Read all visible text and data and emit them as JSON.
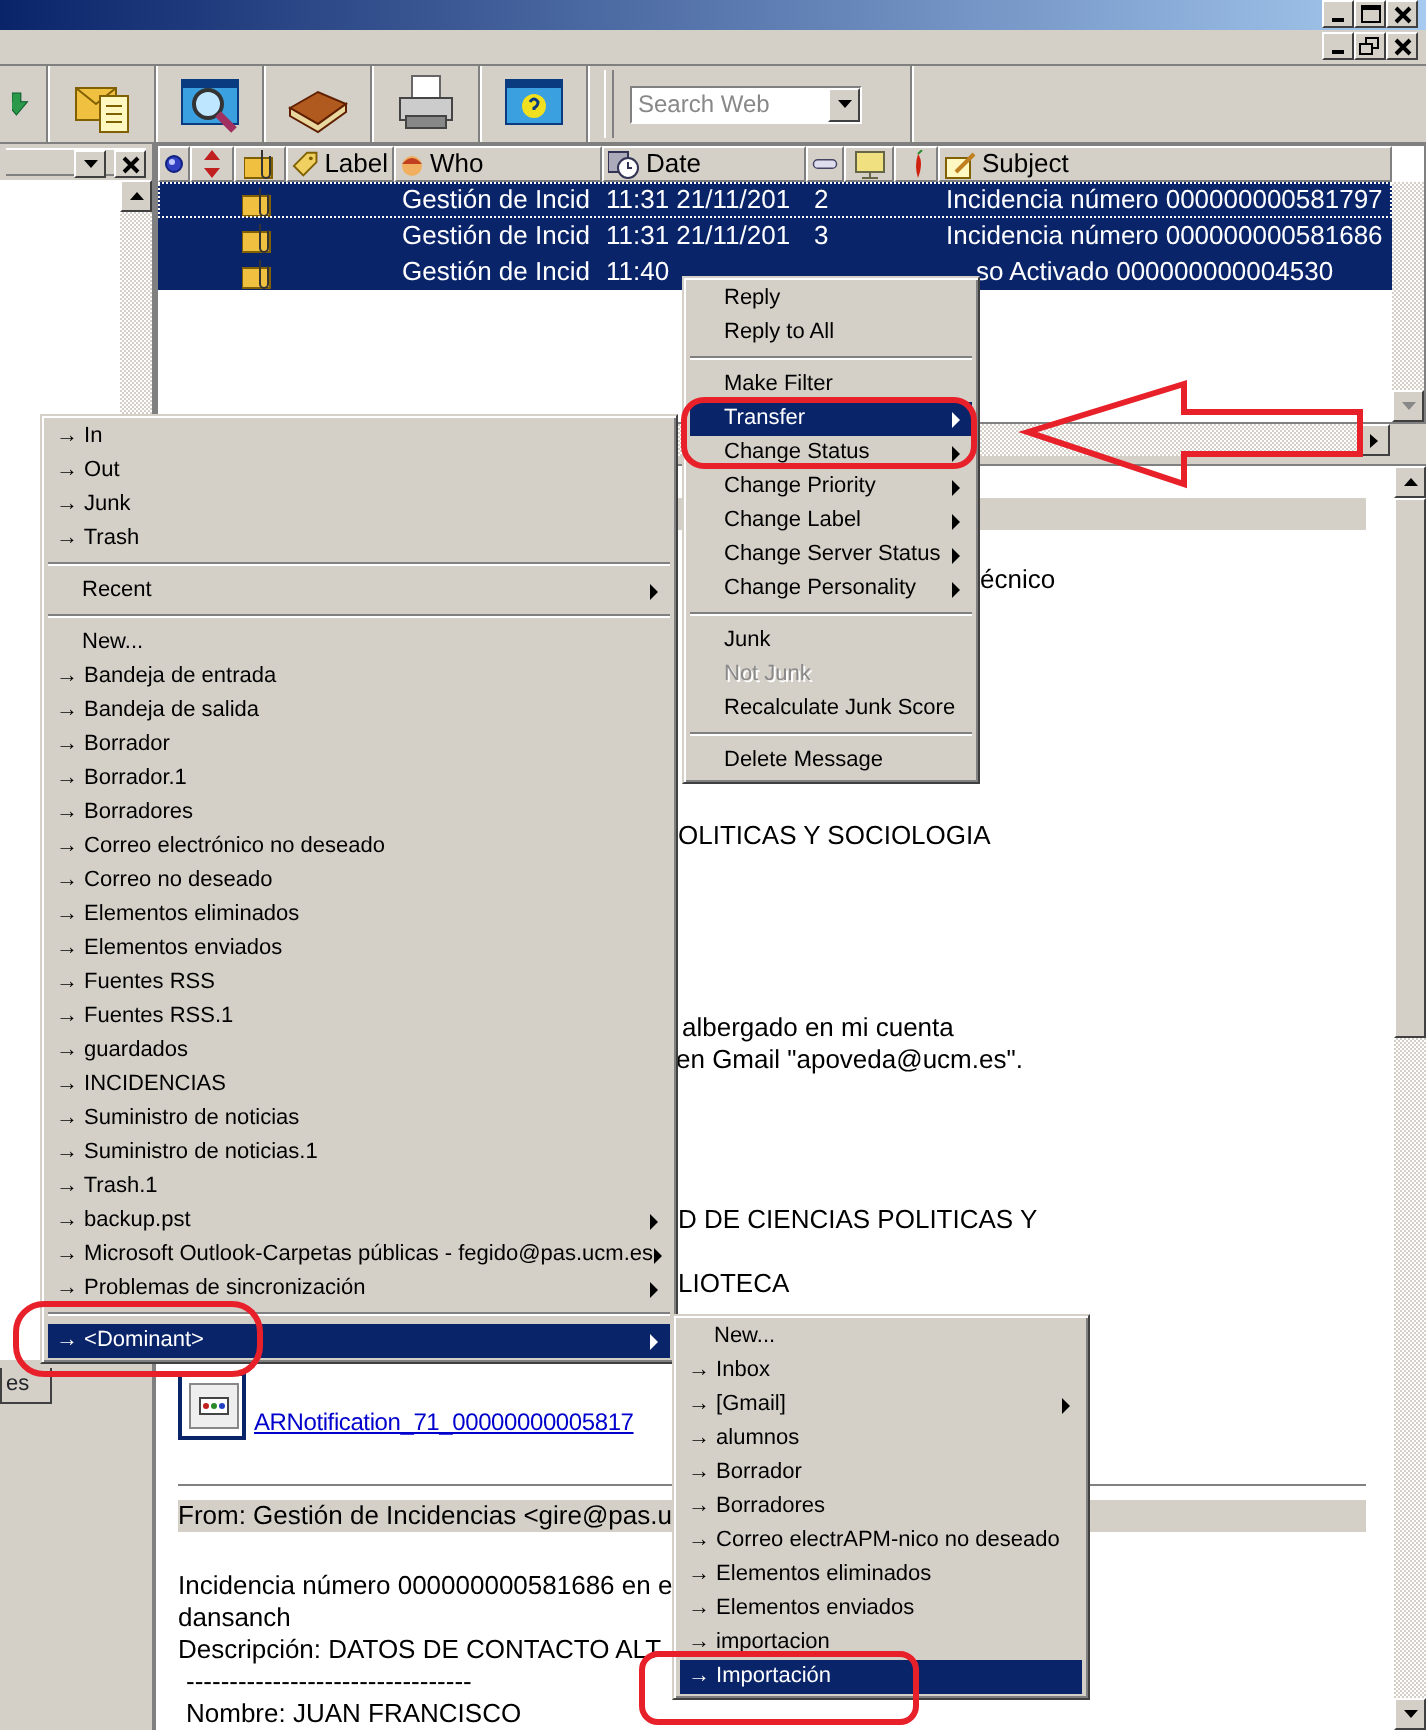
{
  "toolbar": {
    "search": {
      "placeholder": "Search Web"
    }
  },
  "message_list": {
    "columns": [
      {
        "kind": "status"
      },
      {
        "kind": "priority"
      },
      {
        "kind": "attachment"
      },
      {
        "kind": "label",
        "label": "Label"
      },
      {
        "kind": "who",
        "label": "Who"
      },
      {
        "kind": "date",
        "label": "Date"
      },
      {
        "kind": "count"
      },
      {
        "kind": "server"
      },
      {
        "kind": "spam"
      },
      {
        "kind": "subject",
        "label": "Subject"
      }
    ],
    "rows": [
      {
        "attachment": true,
        "who": "Gestión de Incid",
        "date": "11:31 21/11/201",
        "count": "2",
        "subject": "Incidencia número 000000000581797",
        "selected": true
      },
      {
        "attachment": true,
        "who": "Gestión de Incid",
        "date": "11:31 21/11/201",
        "count": "3",
        "subject": "Incidencia número 000000000581686",
        "selected": true
      },
      {
        "attachment": true,
        "who": "Gestión de Incid",
        "date": "11:40",
        "subject": "so Activado 000000000004530",
        "selected": true
      }
    ]
  },
  "left_pane": {
    "tab": "es"
  },
  "preview": {
    "lines": [
      {
        "kind": "band"
      },
      {
        "kind": "text",
        "text": "écnico"
      },
      {
        "kind": "text",
        "text": "OLITICAS Y SOCIOLOGIA"
      },
      {
        "kind": "text",
        "text": "albergado en mi cuenta"
      },
      {
        "kind": "text",
        "text": "en Gmail \"apoveda@ucm.es\"."
      },
      {
        "kind": "text",
        "text": "D DE CIENCIAS POLITICAS Y"
      },
      {
        "kind": "text",
        "text": "LIOTECA"
      },
      {
        "kind": "attachment",
        "text": "ARNotification_71_00000000005817"
      },
      {
        "kind": "rule"
      },
      {
        "kind": "band",
        "text": "From: Gestión de Incidencias <gire@pas.u"
      },
      {
        "kind": "text",
        "text": "Incidencia número 000000000581686 en e"
      },
      {
        "kind": "text",
        "text": "dansanch"
      },
      {
        "kind": "text",
        "text": "Descripción: DATOS DE CONTACTO ALT"
      },
      {
        "kind": "text",
        "text": "---------------------------------"
      },
      {
        "kind": "text",
        "text": "Nombre: JUAN FRANCISCO"
      }
    ]
  },
  "context_menu": [
    {
      "kind": "command",
      "label": "Reply",
      "has_submenu": false,
      "selected": false,
      "disabled": false
    },
    {
      "kind": "command",
      "label": "Reply to All",
      "has_submenu": false,
      "selected": false,
      "disabled": false
    },
    {
      "kind": "separator"
    },
    {
      "kind": "command",
      "label": "Make Filter",
      "has_submenu": false,
      "selected": false,
      "disabled": false
    },
    {
      "kind": "command",
      "label": "Transfer",
      "has_submenu": true,
      "selected": true,
      "disabled": false
    },
    {
      "kind": "command",
      "label": "Change Status",
      "has_submenu": true,
      "selected": false,
      "disabled": false
    },
    {
      "kind": "command",
      "label": "Change Priority",
      "has_submenu": true,
      "selected": false,
      "disabled": false
    },
    {
      "kind": "command",
      "label": "Change Label",
      "has_submenu": true,
      "selected": false,
      "disabled": false
    },
    {
      "kind": "command",
      "label": "Change Server Status",
      "has_submenu": true,
      "selected": false,
      "disabled": false
    },
    {
      "kind": "command",
      "label": "Change Personality",
      "has_submenu": true,
      "selected": false,
      "disabled": false
    },
    {
      "kind": "separator"
    },
    {
      "kind": "command",
      "label": "Junk",
      "has_submenu": false,
      "selected": false,
      "disabled": false
    },
    {
      "kind": "command",
      "label": "Not Junk",
      "has_submenu": false,
      "selected": false,
      "disabled": true
    },
    {
      "kind": "command",
      "label": "Recalculate Junk Score",
      "has_submenu": false,
      "selected": false,
      "disabled": false
    },
    {
      "kind": "separator"
    },
    {
      "kind": "command",
      "label": "Delete Message",
      "has_submenu": false,
      "selected": false,
      "disabled": false
    }
  ],
  "transfer_menu": [
    {
      "kind": "folder",
      "label": "→ In",
      "has_submenu": false,
      "selected": false
    },
    {
      "kind": "folder",
      "label": "→ Out",
      "has_submenu": false,
      "selected": false
    },
    {
      "kind": "folder",
      "label": "→ Junk",
      "has_submenu": false,
      "selected": false
    },
    {
      "kind": "folder",
      "label": "→ Trash",
      "has_submenu": false,
      "selected": false
    },
    {
      "kind": "separator"
    },
    {
      "kind": "command",
      "label": "Recent",
      "has_submenu": true,
      "selected": false
    },
    {
      "kind": "separator"
    },
    {
      "kind": "command",
      "label": "New...",
      "has_submenu": false,
      "selected": false
    },
    {
      "kind": "folder",
      "label": "→ Bandeja de entrada",
      "has_submenu": false,
      "selected": false
    },
    {
      "kind": "folder",
      "label": "→ Bandeja de salida",
      "has_submenu": false,
      "selected": false
    },
    {
      "kind": "folder",
      "label": "→ Borrador",
      "has_submenu": false,
      "selected": false
    },
    {
      "kind": "folder",
      "label": "→ Borrador.1",
      "has_submenu": false,
      "selected": false
    },
    {
      "kind": "folder",
      "label": "→ Borradores",
      "has_submenu": false,
      "selected": false
    },
    {
      "kind": "folder",
      "label": "→ Correo electrónico no deseado",
      "has_submenu": false,
      "selected": false
    },
    {
      "kind": "folder",
      "label": "→ Correo no deseado",
      "has_submenu": false,
      "selected": false
    },
    {
      "kind": "folder",
      "label": "→ Elementos eliminados",
      "has_submenu": false,
      "selected": false
    },
    {
      "kind": "folder",
      "label": "→ Elementos enviados",
      "has_submenu": false,
      "selected": false
    },
    {
      "kind": "folder",
      "label": "→ Fuentes RSS",
      "has_submenu": false,
      "selected": false
    },
    {
      "kind": "folder",
      "label": "→ Fuentes RSS.1",
      "has_submenu": false,
      "selected": false
    },
    {
      "kind": "folder",
      "label": "→ guardados",
      "has_submenu": false,
      "selected": false
    },
    {
      "kind": "folder",
      "label": "→ INCIDENCIAS",
      "has_submenu": false,
      "selected": false
    },
    {
      "kind": "folder",
      "label": "→ Suministro de noticias",
      "has_submenu": false,
      "selected": false
    },
    {
      "kind": "folder",
      "label": "→ Suministro de noticias.1",
      "has_submenu": false,
      "selected": false
    },
    {
      "kind": "folder",
      "label": "→ Trash.1",
      "has_submenu": false,
      "selected": false
    },
    {
      "kind": "folder",
      "label": "→ backup.pst",
      "has_submenu": true,
      "selected": false
    },
    {
      "kind": "folder",
      "label": "→ Microsoft Outlook-Carpetas públicas - fegido@pas.ucm.es",
      "has_submenu": true,
      "selected": false
    },
    {
      "kind": "folder",
      "label": "→ Problemas de sincronización",
      "has_submenu": true,
      "selected": false
    },
    {
      "kind": "separator"
    },
    {
      "kind": "folder",
      "label": "→ <Dominant>",
      "has_submenu": true,
      "selected": true
    }
  ],
  "dominant_menu": [
    {
      "kind": "command",
      "label": "New...",
      "has_submenu": false,
      "selected": false
    },
    {
      "kind": "folder",
      "label": "→ Inbox",
      "has_submenu": false,
      "selected": false
    },
    {
      "kind": "folder",
      "label": "→ [Gmail]",
      "has_submenu": true,
      "selected": false
    },
    {
      "kind": "folder",
      "label": "→ alumnos",
      "has_submenu": false,
      "selected": false
    },
    {
      "kind": "folder",
      "label": "→ Borrador",
      "has_submenu": false,
      "selected": false
    },
    {
      "kind": "folder",
      "label": "→ Borradores",
      "has_submenu": false,
      "selected": false
    },
    {
      "kind": "folder",
      "label": "→ Correo electrAPM-nico no deseado",
      "has_submenu": false,
      "selected": false
    },
    {
      "kind": "folder",
      "label": "→ Elementos eliminados",
      "has_submenu": false,
      "selected": false
    },
    {
      "kind": "folder",
      "label": "→ Elementos enviados",
      "has_submenu": false,
      "selected": false
    },
    {
      "kind": "folder",
      "label": "→ importacion",
      "has_submenu": false,
      "selected": false
    },
    {
      "kind": "folder",
      "label": "→ Importación",
      "has_submenu": false,
      "selected": true
    }
  ]
}
